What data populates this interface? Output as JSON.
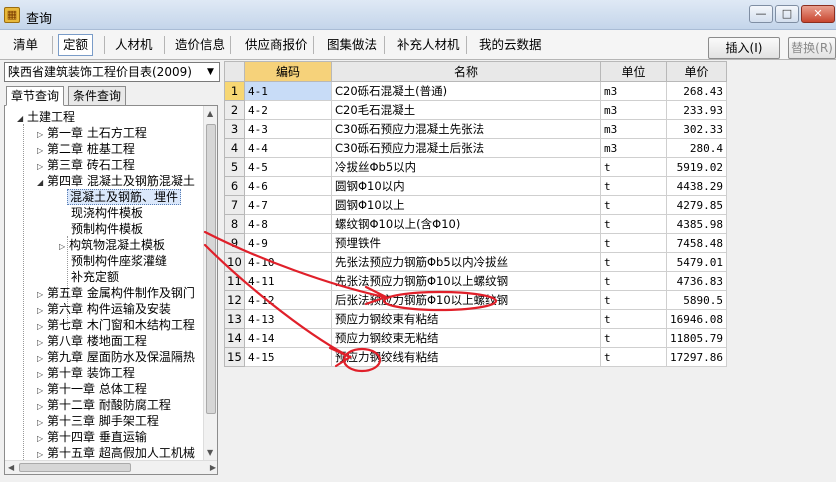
{
  "window": {
    "title": "查询",
    "controls": {
      "minimize": "—",
      "maximize": "□",
      "close": "✕"
    }
  },
  "toolbar": {
    "tabs": [
      "清单",
      "定额",
      "人材机",
      "造价信息",
      "供应商报价",
      "图集做法",
      "补充人材机",
      "我的云数据"
    ],
    "active_tab": "定额",
    "insert_label": "插入(I)",
    "replace_label": "替换(R)"
  },
  "library": {
    "selected": "陕西省建筑装饰工程价目表(2009)"
  },
  "subtabs": [
    "章节查询",
    "条件查询"
  ],
  "tree": {
    "root": "土建工程",
    "items": [
      "第一章  土石方工程",
      "第二章  桩基工程",
      "第三章  砖石工程",
      "第四章  混凝土及钢筋混凝土",
      "混凝土及钢筋、埋件",
      "现浇构件模板",
      "预制构件模板",
      "构筑物混凝土模板",
      "预制构件座浆灌缝",
      "补充定额",
      "第五章  金属构件制作及钢门",
      "第六章  构件运输及安装",
      "第七章  木门窗和木结构工程",
      "第八章  楼地面工程",
      "第九章  屋面防水及保温隔热",
      "第十章  装饰工程",
      "第十一章  总体工程",
      "第十二章  耐酸防腐工程",
      "第十三章  脚手架工程",
      "第十四章  垂直运输",
      "第十五章  超高假加人工机械"
    ]
  },
  "table": {
    "headers": [
      "",
      "编码",
      "名称",
      "单位",
      "单价"
    ],
    "rows": [
      [
        "1",
        "4-1",
        "C20砾石混凝土(普通)",
        "m3",
        "268.43"
      ],
      [
        "2",
        "4-2",
        "C20毛石混凝土",
        "m3",
        "233.93"
      ],
      [
        "3",
        "4-3",
        "C30砾石预应力混凝土先张法",
        "m3",
        "302.33"
      ],
      [
        "4",
        "4-4",
        "C30砾石预应力混凝土后张法",
        "m3",
        "280.4"
      ],
      [
        "5",
        "4-5",
        "冷拔丝Φb5以内",
        "t",
        "5919.02"
      ],
      [
        "6",
        "4-6",
        "圆钢Φ10以内",
        "t",
        "4438.29"
      ],
      [
        "7",
        "4-7",
        "圆钢Φ10以上",
        "t",
        "4279.85"
      ],
      [
        "8",
        "4-8",
        "螺纹钢Φ10以上(含Φ10)",
        "t",
        "4385.98"
      ],
      [
        "9",
        "4-9",
        "预埋铁件",
        "t",
        "7458.48"
      ],
      [
        "10",
        "4-10",
        "先张法预应力钢筋Φb5以内冷拔丝",
        "t",
        "5479.01"
      ],
      [
        "11",
        "4-11",
        "先张法预应力钢筋Φ10以上螺纹钢",
        "t",
        "4736.83"
      ],
      [
        "12",
        "4-12",
        "后张法预应力钢筋Φ10以上螺纹钢",
        "t",
        "5890.5"
      ],
      [
        "13",
        "4-13",
        "预应力钢绞束有粘结",
        "t",
        "16946.08"
      ],
      [
        "14",
        "4-14",
        "预应力钢绞束无粘结",
        "t",
        "11805.79"
      ],
      [
        "15",
        "4-15",
        "预应力钢绞线有粘结",
        "t",
        "17297.86"
      ]
    ]
  },
  "icons": {
    "app": "calculator-icon",
    "expand": "triangle-right-icon",
    "collapse": "triangle-down-icon",
    "dropdown": "chevron-down-icon"
  },
  "colors": {
    "annotation": "#e0202a",
    "selected_row": "#f7d774",
    "selected_cell": "#c8dcf7"
  }
}
